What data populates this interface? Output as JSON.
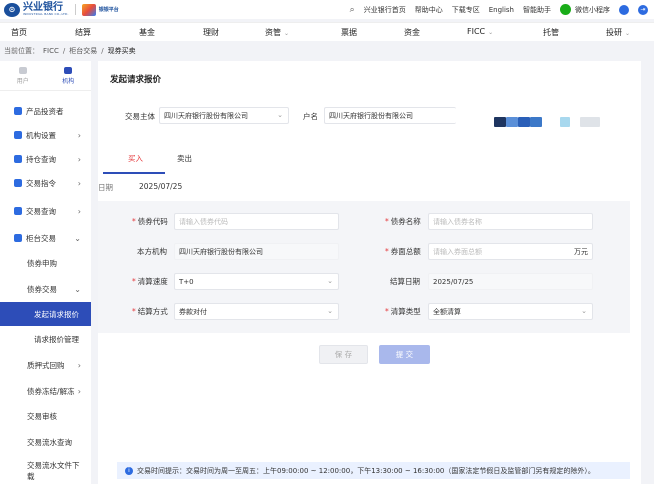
{
  "brand": {
    "name": "兴业银行",
    "sub": "INDUSTRIAL BANK CO.,LTD.",
    "platform": "银银平台"
  },
  "top_links": [
    "兴业银行首页",
    "帮助中心",
    "下载专区",
    "English",
    "智能助手"
  ],
  "mini_program": "微信小程序",
  "nav": [
    {
      "label": "首页",
      "caret": false
    },
    {
      "label": "结算",
      "caret": false
    },
    {
      "label": "基金",
      "caret": false
    },
    {
      "label": "理财",
      "caret": false
    },
    {
      "label": "资管",
      "caret": true
    },
    {
      "label": "票据",
      "caret": false
    },
    {
      "label": "资金",
      "caret": false
    },
    {
      "label": "FICC",
      "caret": true
    },
    {
      "label": "托管",
      "caret": false
    },
    {
      "label": "投研",
      "caret": true
    }
  ],
  "breadcrumb": {
    "prefix": "当前位置：",
    "items": [
      "FICC",
      "柜台交易",
      "现券买卖"
    ]
  },
  "sidebar": {
    "tabs": [
      "用户",
      "机构"
    ],
    "items": [
      {
        "label": "产品投资者",
        "chev": ""
      },
      {
        "label": "机构设置",
        "chev": "›"
      },
      {
        "label": "持仓查询",
        "chev": "›"
      },
      {
        "label": "交易指令",
        "chev": "›"
      },
      {
        "label": "交易查询",
        "chev": "›"
      },
      {
        "label": "柜台交易",
        "chev": "⌄"
      },
      {
        "label": "债券申购",
        "chev": ""
      },
      {
        "label": "债券交易",
        "chev": "⌄"
      },
      {
        "label": "发起请求报价",
        "chev": ""
      },
      {
        "label": "请求报价管理",
        "chev": ""
      },
      {
        "label": "质押式回购",
        "chev": "›"
      },
      {
        "label": "债券冻结/解冻",
        "chev": "›"
      },
      {
        "label": "交易审核",
        "chev": ""
      },
      {
        "label": "交易流水查询",
        "chev": ""
      },
      {
        "label": "交易流水文件下载",
        "chev": ""
      }
    ]
  },
  "page_title": "发起请求报价",
  "top_form": {
    "entity_label": "交易主体",
    "entity_value": "四川天府银行股份有限公司",
    "account_label": "户名",
    "account_value": "四川天府银行股份有限公司"
  },
  "tabs": [
    "买入",
    "卖出"
  ],
  "date": {
    "label": "日期",
    "value": "2025/07/25"
  },
  "form": {
    "bond_code_label": "债券代码",
    "bond_code_placeholder": "请输入债券代码",
    "bond_name_label": "债券名称",
    "bond_name_placeholder": "请输入债券名称",
    "institution_label": "本方机构",
    "institution_value": "四川天府银行股份有限公司",
    "face_label": "券面总额",
    "face_placeholder": "请输入券面总额",
    "face_unit": "万元",
    "speed_label": "清算速度",
    "speed_value": "T+0",
    "settle_date_label": "结算日期",
    "settle_date_value": "2025/07/25",
    "settle_method_label": "结算方式",
    "settle_method_value": "券款对付",
    "clear_type_label": "清算类型",
    "clear_type_value": "全额清算"
  },
  "buttons": {
    "save": "保 存",
    "submit": "提 交"
  },
  "notice": "交易时间提示：交易时间为周一至周五：上午09:00:00 ~ 12:00:00，下午13:30:00 ~ 16:30:00（国家法定节假日及监管部门另有规定的除外）。",
  "colors": {
    "primary": "#2d4db8",
    "accent_red": "#e4393c",
    "brand_blue": "#1a4f9c"
  }
}
